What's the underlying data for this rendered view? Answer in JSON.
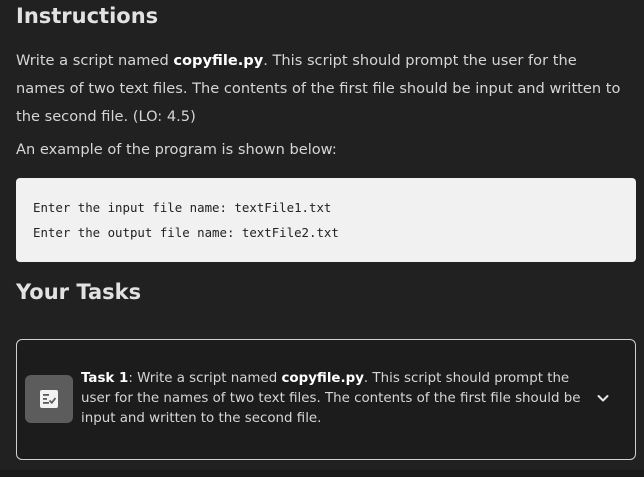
{
  "instructions": {
    "heading": "Instructions",
    "p1_pre": "Write a script named ",
    "p1_bold": "copyfile.py",
    "p1_post": ". This script should prompt the user for the names of two text files. The contents of the first file should be input and written to the second file. (LO: 4.5)",
    "p2": "An example of the program is shown below:",
    "code_lines": [
      "Enter the input file name: textFile1.txt",
      "Enter the output file name: textFile2.txt"
    ]
  },
  "tasks": {
    "heading": "Your Tasks",
    "items": [
      {
        "label": "Task 1",
        "sep": ": Write a script named ",
        "bold": "copyfile.py",
        "rest": ". This script should prompt the user for the names of two text files. The contents of the first file should be input and written to the second file.",
        "icon": "task-checklist-icon",
        "toggle_icon": "chevron-down-icon"
      }
    ]
  }
}
